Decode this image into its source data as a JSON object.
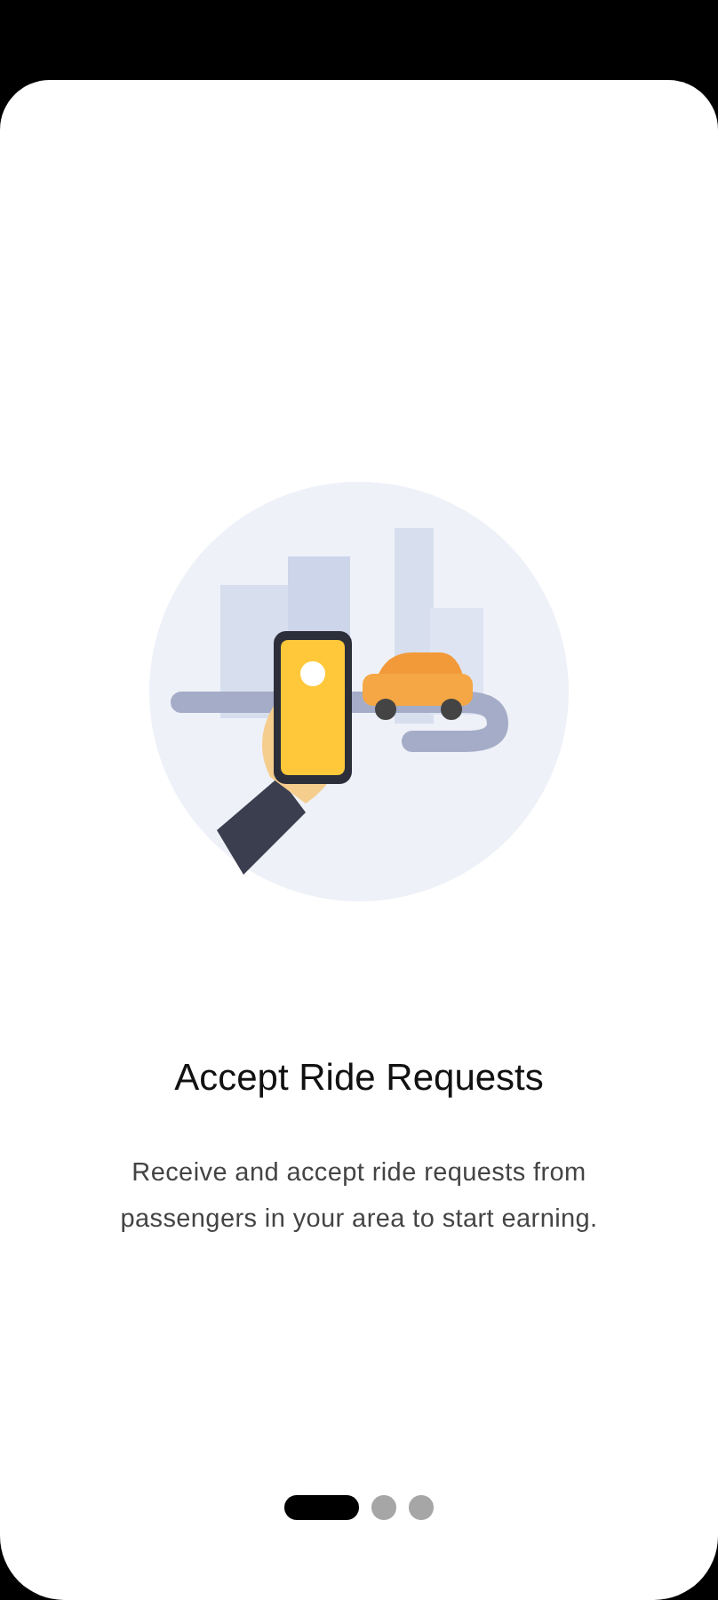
{
  "onboarding": {
    "title": "Accept Ride Requests",
    "description": "Receive and accept ride requests from passengers in your area to start earning."
  },
  "pager": [
    {
      "selected": true
    },
    {
      "selected": false
    },
    {
      "selected": false
    }
  ]
}
